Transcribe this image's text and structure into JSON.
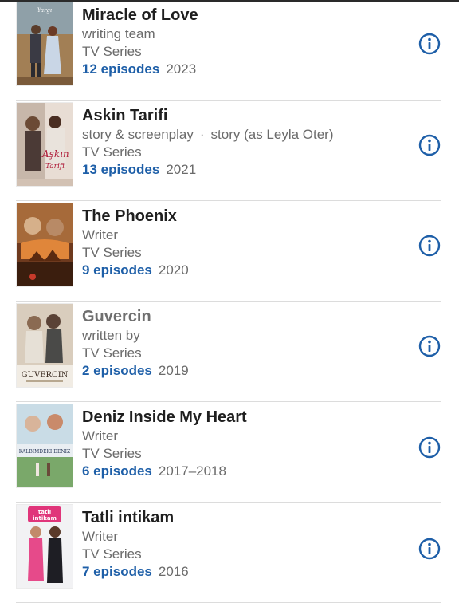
{
  "credits": [
    {
      "title": "Miracle of Love",
      "roles": [
        "writing team"
      ],
      "type": "TV Series",
      "episodes": "12 episodes",
      "years": "2023",
      "poster_icon": "poster-image",
      "info_icon": "info-circle-icon"
    },
    {
      "title": "Askin Tarifi",
      "roles": [
        "story & screenplay",
        "story (as Leyla Oter)"
      ],
      "role_separator": "·",
      "type": "TV Series",
      "episodes": "13 episodes",
      "years": "2021",
      "poster_icon": "poster-image",
      "info_icon": "info-circle-icon"
    },
    {
      "title": "The Phoenix",
      "roles": [
        "Writer"
      ],
      "type": "TV Series",
      "episodes": "9 episodes",
      "years": "2020",
      "poster_icon": "poster-image",
      "info_icon": "info-circle-icon"
    },
    {
      "title": "Guvercin",
      "roles": [
        "written by"
      ],
      "type": "TV Series",
      "episodes": "2 episodes",
      "years": "2019",
      "poster_icon": "poster-image",
      "info_icon": "info-circle-icon"
    },
    {
      "title": "Deniz Inside My Heart",
      "roles": [
        "Writer"
      ],
      "type": "TV Series",
      "episodes": "6 episodes",
      "years": "2017–2018",
      "poster_icon": "poster-image",
      "info_icon": "info-circle-icon"
    },
    {
      "title": "Tatli intikam",
      "roles": [
        "Writer"
      ],
      "type": "TV Series",
      "episodes": "7 episodes",
      "years": "2016",
      "poster_icon": "poster-image",
      "info_icon": "info-circle-icon"
    }
  ],
  "poster_text": {
    "askin": "Aşkın Tarifi",
    "guvercin": "GUVERCIN",
    "deniz": "KALBIMDEKI DENIZ",
    "tatli": "tatlı intikam"
  },
  "colors": {
    "episodes_link": "#1e5fa8",
    "info_icon": "#1e5fa8",
    "title": "#1f1f1f",
    "meta": "#6b6b6b",
    "divider": "#dcdcdc"
  }
}
